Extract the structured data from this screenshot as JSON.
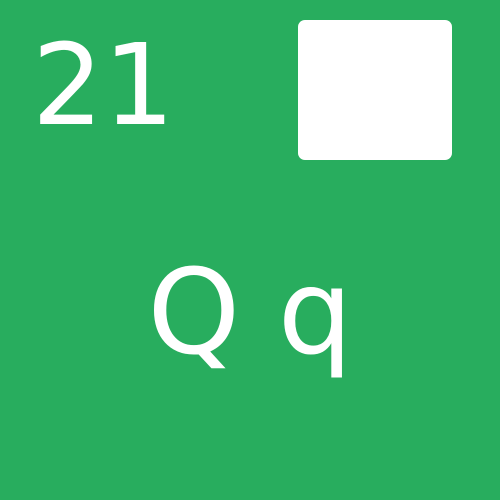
{
  "card": {
    "number": "21",
    "letters": "Q q",
    "background_color": "#28ad5e",
    "foreground_color": "#ffffff"
  }
}
